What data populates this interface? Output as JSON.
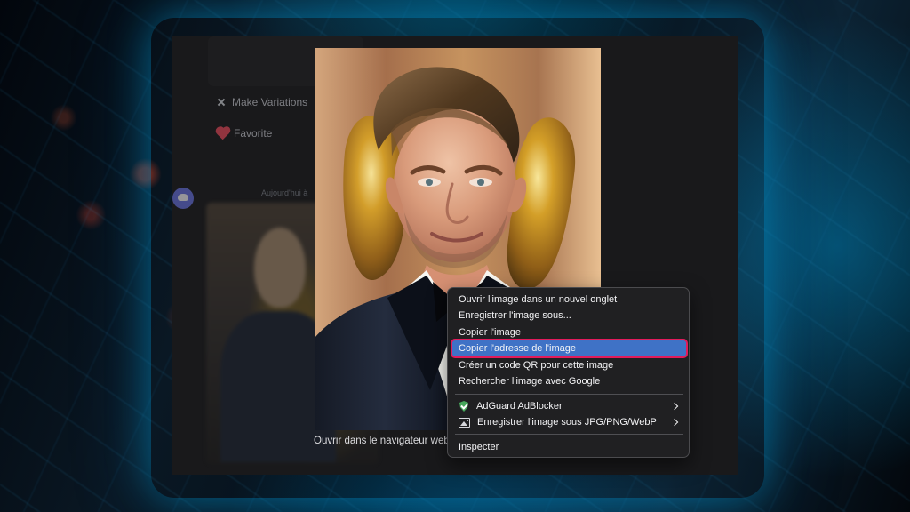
{
  "background": {
    "theme_colors": {
      "glow": "#00bfff",
      "deep_blue": "#04101a",
      "ember": "#ff4d28"
    }
  },
  "app_ui": {
    "left_actions": [
      {
        "label": "Make Variations",
        "icon": "spark-icon"
      },
      {
        "label": "Favorite",
        "icon": "heart-icon"
      }
    ],
    "caption_fragment": "Aujourd'hui à",
    "bottom_link": "Ouvrir dans le navigateur web"
  },
  "image": {
    "description_icon": "portrait-image"
  },
  "context_menu": {
    "items": [
      {
        "label": "Ouvrir l'image dans un nouvel onglet",
        "interactable": true
      },
      {
        "label": "Enregistrer l'image sous...",
        "interactable": true
      },
      {
        "label": "Copier l'image",
        "interactable": true
      },
      {
        "label": "Copier l'adresse de l'image",
        "interactable": true,
        "selected": true
      },
      {
        "label": "Créer un code QR pour cette image",
        "interactable": true
      },
      {
        "label": "Rechercher l'image avec Google",
        "interactable": true
      },
      {
        "label": "AdGuard AdBlocker",
        "interactable": true,
        "icon": "shield-icon",
        "submenu": true
      },
      {
        "label": "Enregistrer l'image sous JPG/PNG/WebP",
        "interactable": true,
        "icon": "image-icon",
        "submenu": true
      },
      {
        "label": "Inspecter",
        "interactable": true
      }
    ],
    "highlight_color": "#3f72c6",
    "focus_outline_color": "#e21b5b"
  }
}
